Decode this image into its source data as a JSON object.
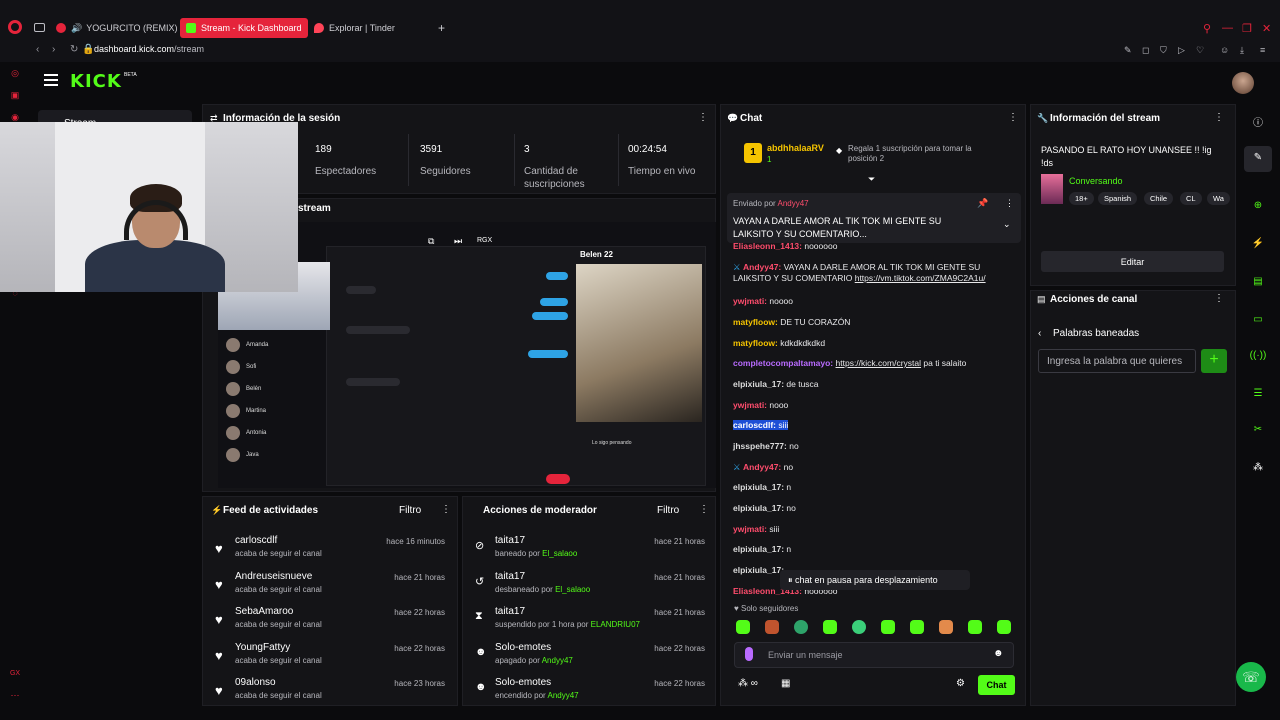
{
  "browser": {
    "tabs": [
      {
        "label": "YOGURCITO (REMIX)"
      },
      {
        "label": "Stream - Kick Dashboard"
      },
      {
        "label": "Explorar | Tinder"
      }
    ],
    "new_tab": "+",
    "url_host": "dashboard.kick.com",
    "url_path": "/stream",
    "accent": "#e5243b"
  },
  "kick": {
    "logo": "KICK",
    "beta": "BETA",
    "accent": "#53fc18"
  },
  "sidebar": {
    "active_item": "Stream"
  },
  "session": {
    "title": "Información de la sesión",
    "stats": [
      {
        "value": "189",
        "label": "Espectadores"
      },
      {
        "value": "3591",
        "label": "Seguidores"
      },
      {
        "value": "3",
        "label": "Cantidad de suscripciones"
      },
      {
        "value": "00:24:54",
        "label": "Tiempo en vivo"
      }
    ]
  },
  "preview": {
    "title": "stream",
    "contact": "Belen 22",
    "toolbar_label": "RGX",
    "list": [
      "Amanda",
      "Sofi",
      "Belén",
      "Martina",
      "Antonia",
      "Java"
    ],
    "reply_label": "Lo sigo pensando"
  },
  "feed": {
    "title": "Feed de actividades",
    "filter": "Filtro",
    "items": [
      {
        "name": "carloscdlf",
        "sub": "acaba de seguir el canal",
        "time": "hace 16 minutos"
      },
      {
        "name": "Andreuseisnueve",
        "sub": "acaba de seguir el canal",
        "time": "hace 21 horas"
      },
      {
        "name": "SebaAmaroo",
        "sub": "acaba de seguir el canal",
        "time": "hace 22 horas"
      },
      {
        "name": "YoungFattyy",
        "sub": "acaba de seguir el canal",
        "time": "hace 22 horas"
      },
      {
        "name": "09alonso",
        "sub": "acaba de seguir el canal",
        "time": "hace 23 horas"
      }
    ]
  },
  "mod": {
    "title": "Acciones de moderador",
    "filter": "Filtro",
    "items": [
      {
        "name": "taita17",
        "sub": "baneado por ",
        "by": "El_salaoo",
        "time": "hace 21 horas"
      },
      {
        "name": "taita17",
        "sub": "desbaneado por ",
        "by": "El_salaoo",
        "time": "hace 21 horas"
      },
      {
        "name": "taita17",
        "sub": "suspendido por 1 hora por ",
        "by": "ELANDRIU07",
        "time": "hace 21 horas"
      },
      {
        "name": "Solo-emotes",
        "sub": "apagado por ",
        "by": "Andyy47",
        "time": "hace 22 horas"
      },
      {
        "name": "Solo-emotes",
        "sub": "encendido por ",
        "by": "Andyy47",
        "time": "hace 22 horas"
      }
    ]
  },
  "chat": {
    "title": "Chat",
    "top_gifter": "abdhhalaaRV",
    "top_gifter_count": "1",
    "gift_text": "Regala 1 suscripción para tomar la posición 2",
    "pinned_by_label": "Enviado por",
    "pinned_by": "Andyy47",
    "pinned_text": "VAYAN A DARLE AMOR AL TIK TOK MI GENTE SU LAIKSITO Y SU COMENTARIO...",
    "messages": [
      {
        "user": "Eliasleonn_1413",
        "color": "#ff4d6d",
        "text": "noooooo"
      },
      {
        "user": "Andyy47",
        "color": "#ff4d6d",
        "text": "VAYAN A DARLE AMOR AL TIK TOK MI GENTE SU",
        "text2": "LAIKSITO Y SU COMENTARIO ",
        "link": "https://vm.tiktok.com/ZMA9C2A1u/"
      },
      {
        "user": "ywjmati",
        "color": "#ff4d6d",
        "text": "noooo"
      },
      {
        "user": "matyfloow",
        "color": "#f5c400",
        "text": "DE TU CORAZÓN"
      },
      {
        "user": "matyfloow",
        "color": "#f5c400",
        "text": "kdkdkdkdkd"
      },
      {
        "user": "completocompaltamayo",
        "color": "#b96bff",
        "link": "https://kick.com/crystal",
        "text": " pa ti salaito"
      },
      {
        "user": "elpixiula_17",
        "color": "#dcdcdc",
        "text": "de tusca"
      },
      {
        "user": "ywjmati",
        "color": "#ff4d6d",
        "text": "nooo"
      },
      {
        "user": "carloscdlf",
        "color": "#ffffff",
        "text": "siii"
      },
      {
        "user": "jhsspehe777",
        "color": "#dcdcdc",
        "text": "no"
      },
      {
        "user": "Andyy47",
        "color": "#ff4d6d",
        "text": "no"
      },
      {
        "user": "elpixiula_17",
        "color": "#dcdcdc",
        "text": "n"
      },
      {
        "user": "elpixiula_17",
        "color": "#dcdcdc",
        "text": "no"
      },
      {
        "user": "ywjmati",
        "color": "#ff4d6d",
        "text": "siii"
      },
      {
        "user": "elpixiula_17",
        "color": "#dcdcdc",
        "text": "n"
      },
      {
        "user": "elpixiula_17",
        "color": "#dcdcdc",
        "text": "..."
      },
      {
        "user": "Eliasleonn_1413",
        "color": "#ff4d6d",
        "text": "noooooo"
      }
    ],
    "paused": "chat en pausa para desplazamiento",
    "mode": "Solo seguidores",
    "input_placeholder": "Enviar un mensaje",
    "send": "Chat"
  },
  "stream_info": {
    "title": "Información del stream",
    "stream_title": "PASANDO EL RATO HOY UNANSEE !! !ig !ds",
    "category": "Conversando",
    "tags": [
      "18+",
      "Spanish",
      "Chile",
      "CL",
      "Wa"
    ],
    "edit": "Editar"
  },
  "channel_actions": {
    "title": "Acciones de canal",
    "section": "Palabras baneadas",
    "input_placeholder": "Ingresa la palabra que quieres",
    "add": "+"
  }
}
